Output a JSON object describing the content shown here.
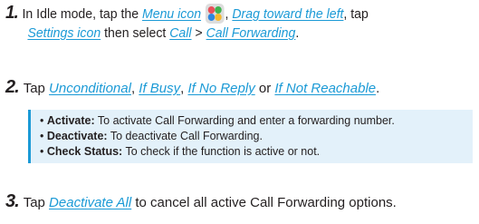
{
  "step1": {
    "number": "1.",
    "t1": "In Idle mode, tap the",
    "menu_icon": "Menu icon",
    "t2": ",",
    "drag": "Drag toward the left",
    "t3": ", tap",
    "settings_icon": "Settings icon",
    "t4": "then select",
    "call": "Call",
    "sep": ">",
    "call_forwarding": "Call Forwarding",
    "t5": "."
  },
  "step2": {
    "number": "2.",
    "t1": "Tap",
    "unconditional": "Unconditional",
    "c1": ",",
    "if_busy": "If Busy",
    "c2": ",",
    "if_no_reply": "If No Reply",
    "or": "or",
    "if_not_reachable": "If Not Reachable",
    "end": "."
  },
  "notes": [
    {
      "term": "Activate:",
      "desc": "To activate Call Forwarding and enter a forwarding number."
    },
    {
      "term": "Deactivate:",
      "desc": "To deactivate Call Forwarding."
    },
    {
      "term": "Check Status:",
      "desc": "To check if the function is active or not."
    }
  ],
  "step3": {
    "number": "3.",
    "t1": "Tap",
    "deactivate_all": "Deactivate All",
    "t2": "to cancel all active Call Forwarding options."
  },
  "icons": [
    "menu-grid-icon"
  ],
  "colors": {
    "accent": "#1b9ad6",
    "note_bg": "#e3f1fa",
    "text": "#231f20"
  }
}
